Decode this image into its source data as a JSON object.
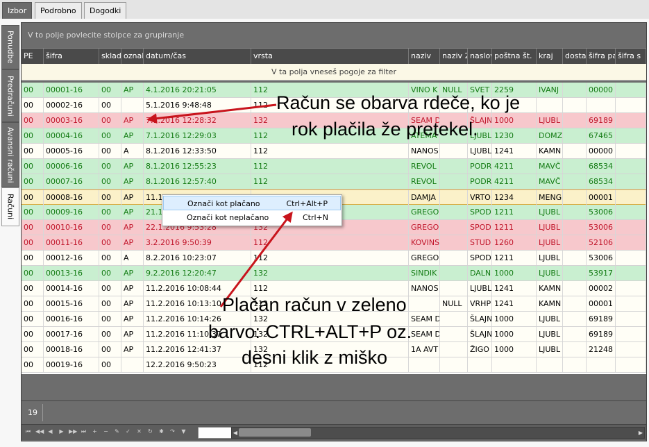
{
  "top_tabs": [
    "Izbor",
    "Podrobno",
    "Dogodki"
  ],
  "side_tabs": [
    "Ponudbe",
    "Predračuni",
    "Avansni računi",
    "Računi"
  ],
  "grid": {
    "group_hint": "V to polje povlecite stolpce za grupiranje",
    "filter_hint": "V ta polja vneseš pogoje za filter",
    "columns": [
      "PE",
      "šifra",
      "sklad",
      "oznal",
      "datum/čas",
      "vrsta",
      "naziv",
      "naziv 2",
      "naslov",
      "poštna št.",
      "kraj",
      "dosta",
      "šifra pa",
      "šifra s"
    ],
    "rows": [
      {
        "status": "paid",
        "cells": [
          "00",
          "00001-16",
          "00",
          "AP",
          "4.1.2016 20:21:05",
          "112",
          "VINO K",
          "NULL",
          "SVET",
          "2259",
          "IVANJ",
          "",
          "00000",
          ""
        ]
      },
      {
        "status": "norm",
        "cells": [
          "00",
          "00002-16",
          "00",
          "",
          "5.1.2016 9:48:48",
          "112",
          "",
          "",
          "",
          "",
          "",
          "",
          "",
          ""
        ]
      },
      {
        "status": "late",
        "cells": [
          "00",
          "00003-16",
          "00",
          "AP",
          "7.1.2016 12:28:32",
          "132",
          "SEAM D",
          "",
          "ŠLAJN",
          "1000",
          "LJUBL",
          "",
          "69189",
          ""
        ]
      },
      {
        "status": "paid",
        "cells": [
          "00",
          "00004-16",
          "00",
          "AP",
          "7.1.2016 12:29:03",
          "112",
          "ATEMA",
          "",
          "LJUBL",
          "1230",
          "DOMZ",
          "",
          "67465",
          ""
        ]
      },
      {
        "status": "norm",
        "cells": [
          "00",
          "00005-16",
          "00",
          "A",
          "8.1.2016 12:33:50",
          "112",
          "NANOS",
          "",
          "LJUBL",
          "1241",
          "KAMN",
          "",
          "00000",
          ""
        ]
      },
      {
        "status": "paid",
        "cells": [
          "00",
          "00006-16",
          "00",
          "AP",
          "8.1.2016 12:55:23",
          "112",
          "REVOL",
          "",
          "PODR",
          "4211",
          "MAVČ",
          "",
          "68534",
          ""
        ]
      },
      {
        "status": "paid",
        "cells": [
          "00",
          "00007-16",
          "00",
          "AP",
          "8.1.2016 12:57:40",
          "112",
          "REVOL",
          "",
          "PODR",
          "4211",
          "MAVČ",
          "",
          "68534",
          ""
        ]
      },
      {
        "status": "sel",
        "cells": [
          "00",
          "00008-16",
          "00",
          "AP",
          "11.1",
          "",
          "DAMJA",
          "",
          "VRTO",
          "1234",
          "MENG",
          "",
          "00001",
          ""
        ]
      },
      {
        "status": "paid",
        "cells": [
          "00",
          "00009-16",
          "00",
          "AP",
          "21.1",
          "",
          "GREGO",
          "",
          "SPOD",
          "1211",
          "LJUBL",
          "",
          "53006",
          ""
        ]
      },
      {
        "status": "late",
        "cells": [
          "00",
          "00010-16",
          "00",
          "AP",
          "22.1.2016 9:53:28",
          "132",
          "GREGO",
          "",
          "SPOD",
          "1211",
          "LJUBL",
          "",
          "53006",
          ""
        ]
      },
      {
        "status": "late",
        "cells": [
          "00",
          "00011-16",
          "00",
          "AP",
          "3.2.2016 9:50:39",
          "112",
          "KOVINS",
          "",
          "STUD",
          "1260",
          "LJUBL",
          "",
          "52106",
          ""
        ]
      },
      {
        "status": "norm",
        "cells": [
          "00",
          "00012-16",
          "00",
          "A",
          "8.2.2016 10:23:07",
          "112",
          "GREGO",
          "",
          "SPOD",
          "1211",
          "LJUBL",
          "",
          "53006",
          ""
        ]
      },
      {
        "status": "paid",
        "cells": [
          "00",
          "00013-16",
          "00",
          "AP",
          "9.2.2016 12:20:47",
          "132",
          "SINDIK",
          "",
          "DALN",
          "1000",
          "LJUBL",
          "",
          "53917",
          ""
        ]
      },
      {
        "status": "norm",
        "cells": [
          "00",
          "00014-16",
          "00",
          "AP",
          "11.2.2016 10:08:44",
          "112",
          "NANOS",
          "",
          "LJUBL",
          "1241",
          "KAMN",
          "",
          "00002",
          ""
        ]
      },
      {
        "status": "norm",
        "cells": [
          "00",
          "00015-16",
          "00",
          "AP",
          "11.2.2016 10:13:10",
          "112",
          "",
          "NULL",
          "VRHP",
          "1241",
          "KAMN",
          "",
          "00001",
          ""
        ]
      },
      {
        "status": "norm",
        "cells": [
          "00",
          "00016-16",
          "00",
          "AP",
          "11.2.2016 10:14:26",
          "132",
          "SEAM D",
          "",
          "ŠLAJN",
          "1000",
          "LJUBL",
          "",
          "69189",
          ""
        ]
      },
      {
        "status": "norm",
        "cells": [
          "00",
          "00017-16",
          "00",
          "AP",
          "11.2.2016 11:10:37",
          "132",
          "SEAM D",
          "",
          "ŠLAJN",
          "1000",
          "LJUBL",
          "",
          "69189",
          ""
        ]
      },
      {
        "status": "norm",
        "cells": [
          "00",
          "00018-16",
          "00",
          "AP",
          "11.2.2016 12:41:37",
          "132",
          "1A AVT",
          "",
          "ŽIGO",
          "1000",
          "LJUBL",
          "",
          "21248",
          ""
        ]
      },
      {
        "status": "norm",
        "cells": [
          "00",
          "00019-16",
          "00",
          "",
          "12.2.2016 9:50:23",
          "112",
          "",
          "",
          "",
          "",
          "",
          "",
          "",
          ""
        ]
      }
    ],
    "record_count": "19"
  },
  "context_menu": {
    "items": [
      {
        "label": "Označi kot plačano",
        "shortcut": "Ctrl+Alt+P"
      },
      {
        "label": "Označi kot neplačano",
        "shortcut": "Ctrl+N"
      }
    ]
  },
  "annotations": {
    "red_note_line1": "Račun se obarva rdeče, ko je",
    "red_note_line2": "rok plačila že pretekel.",
    "green_note_line1": "Plačan račun v zeleno",
    "green_note_line2": "barvo: CTRL+ALT+P oz.",
    "green_note_line3": "desni klik z miško"
  },
  "colors": {
    "paid_row": "#c9efd0",
    "paid_text": "#127a12",
    "late_row": "#f7c8cc",
    "late_text": "#c0152a",
    "arrow": "#c8141c"
  },
  "icons": {
    "nav_buttons": [
      "first-icon",
      "prev-page-icon",
      "prev-icon",
      "next-icon",
      "next-page-icon",
      "last-icon",
      "add-icon",
      "delete-icon",
      "edit-icon",
      "confirm-icon",
      "cancel-icon",
      "refresh-icon",
      "bookmark-icon",
      "goto-icon",
      "filter-icon"
    ]
  }
}
